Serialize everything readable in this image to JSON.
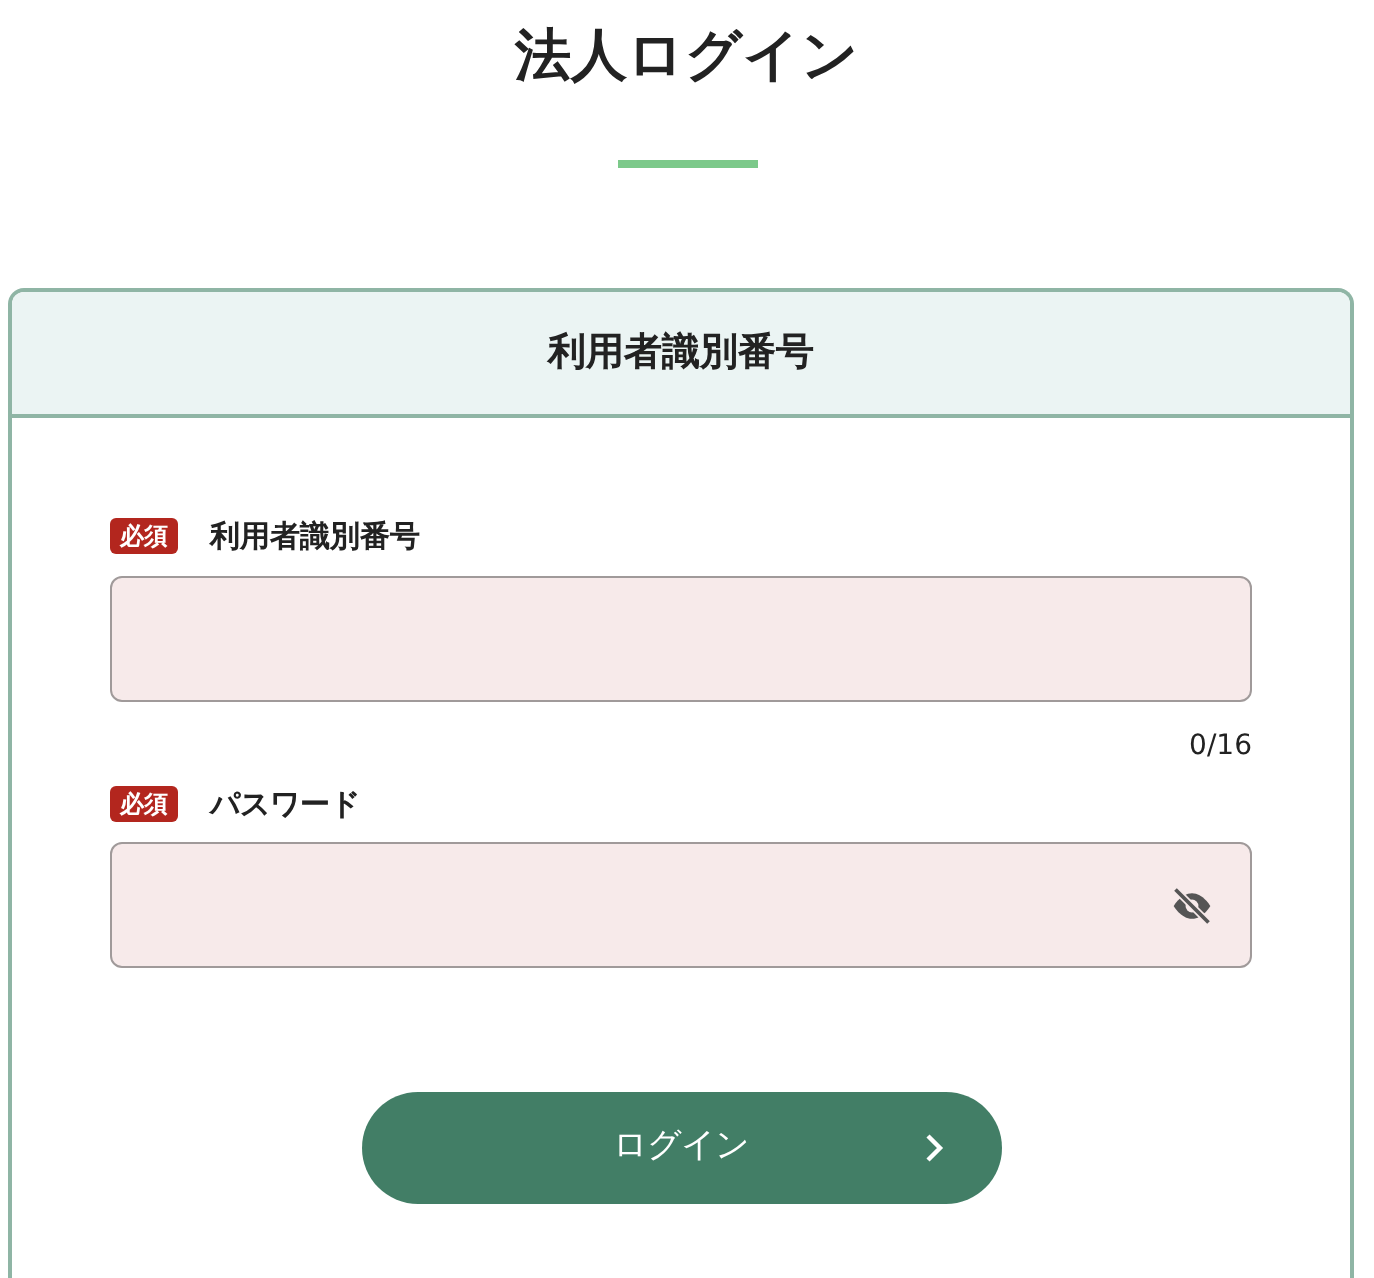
{
  "page_title": "法人ログイン",
  "card": {
    "header": "利用者識別番号",
    "fields": [
      {
        "kind": "text",
        "badge": "必須",
        "label": "利用者識別番号",
        "counter": "0/16"
      },
      {
        "kind": "password",
        "badge": "必須",
        "label": "パスワード",
        "visible": false
      }
    ],
    "button": {
      "label": "ログイン"
    }
  }
}
